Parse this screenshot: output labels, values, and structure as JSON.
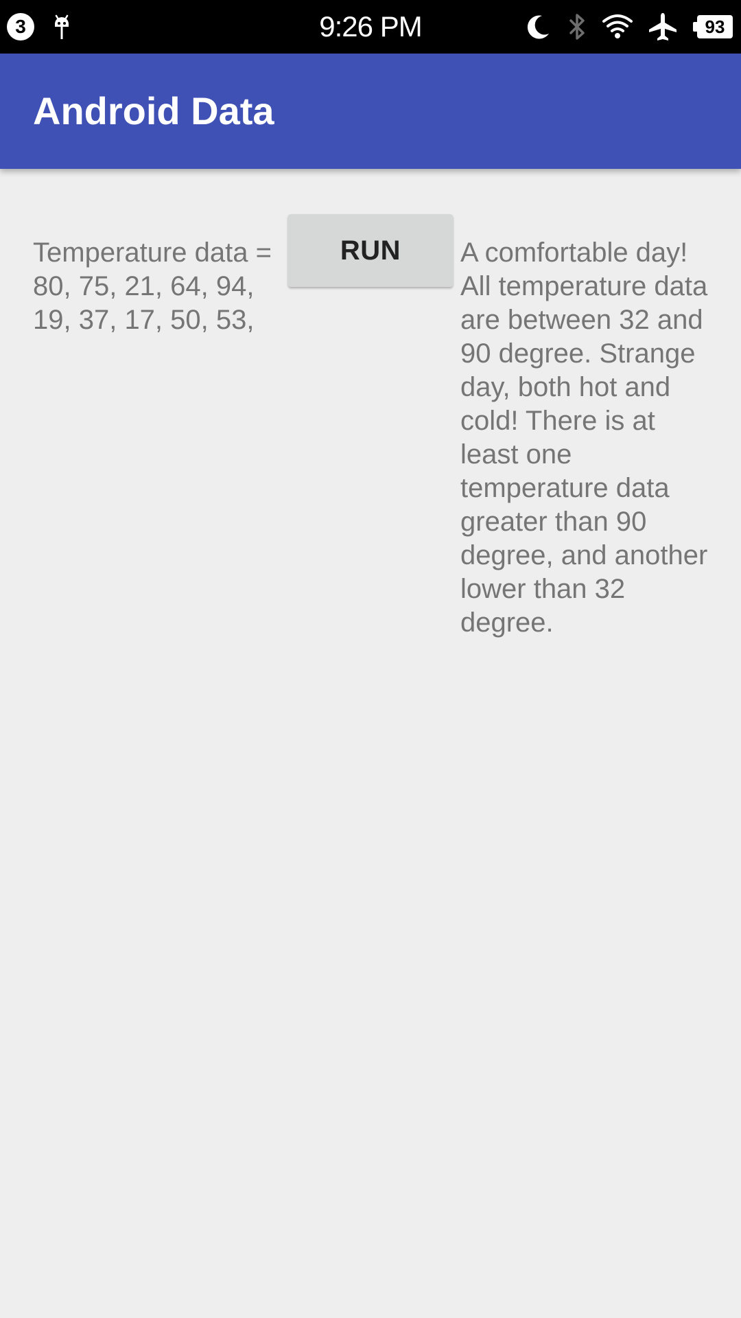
{
  "status_bar": {
    "notification_count": "3",
    "time": "9:26 PM",
    "battery_level": "93",
    "icons": [
      "android-debug-icon",
      "moon-icon",
      "bluetooth-icon",
      "wifi-icon",
      "airplane-icon",
      "battery-icon"
    ]
  },
  "app_bar": {
    "title": "Android Data",
    "color": "#3f51b5"
  },
  "main": {
    "temperature_text": "Temperature data = 80, 75, 21, 64, 94, 19, 37, 17, 50, 53,",
    "run_button_label": "RUN",
    "result_text": "A comfortable day! All temperature data are between 32 and 90 degree. Strange day, both hot and cold! There is at least one temperature data greater than 90 degree, and another lower than 32 degree."
  }
}
